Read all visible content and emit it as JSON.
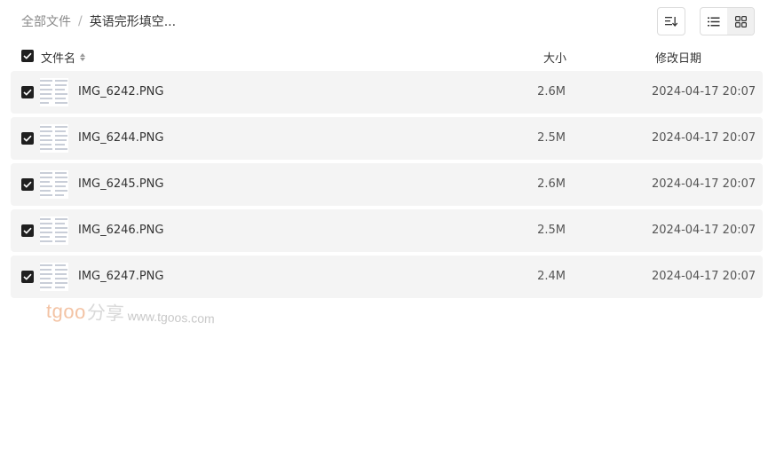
{
  "breadcrumb": {
    "root": "全部文件",
    "separator": "/",
    "current": "英语完形填空..."
  },
  "toolbar": {
    "sort_icon": "sort-icon",
    "view_list_icon": "list-view-icon",
    "view_grid_icon": "grid-view-icon",
    "active_view": "grid"
  },
  "table": {
    "columns": {
      "name": "文件名",
      "size": "大小",
      "date": "修改日期"
    },
    "rows": [
      {
        "name": "IMG_6242.PNG",
        "size": "2.6M",
        "date": "2024-04-17 20:07",
        "checked": true
      },
      {
        "name": "IMG_6244.PNG",
        "size": "2.5M",
        "date": "2024-04-17 20:07",
        "checked": true
      },
      {
        "name": "IMG_6245.PNG",
        "size": "2.6M",
        "date": "2024-04-17 20:07",
        "checked": true
      },
      {
        "name": "IMG_6246.PNG",
        "size": "2.5M",
        "date": "2024-04-17 20:07",
        "checked": true
      },
      {
        "name": "IMG_6247.PNG",
        "size": "2.4M",
        "date": "2024-04-17 20:07",
        "checked": true
      }
    ]
  },
  "watermark": {
    "brand": "tgoo",
    "cn": "分享",
    "url": "www.tgoos.com"
  },
  "colors": {
    "row_bg": "#f4f4f4",
    "checkbox": "#1f1f1f",
    "watermark_brand": "#f3c3a4"
  }
}
